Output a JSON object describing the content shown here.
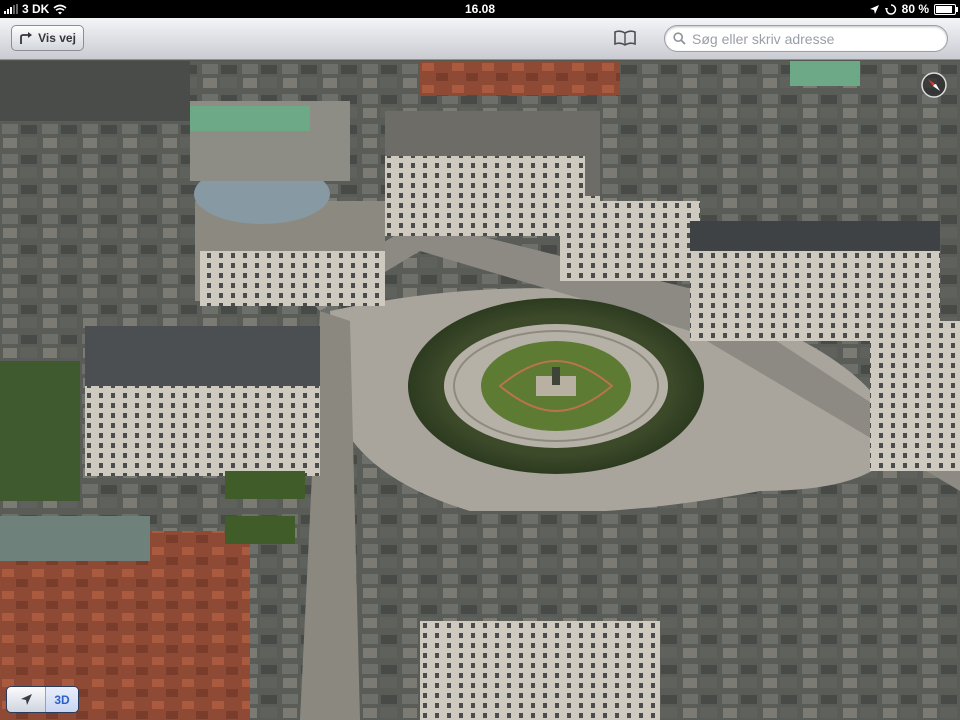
{
  "status_bar": {
    "carrier": "3 DK",
    "time": "16.08",
    "battery": "80 %"
  },
  "toolbar": {
    "directions_label": "Vis vej",
    "search_placeholder": "Søg eller skriv adresse"
  },
  "map": {
    "view_mode_label": "3D"
  },
  "colors": {
    "accent": "#2a62c8",
    "toolbar_top": "#f4f5f7",
    "toolbar_bottom": "#c9ccd2"
  }
}
